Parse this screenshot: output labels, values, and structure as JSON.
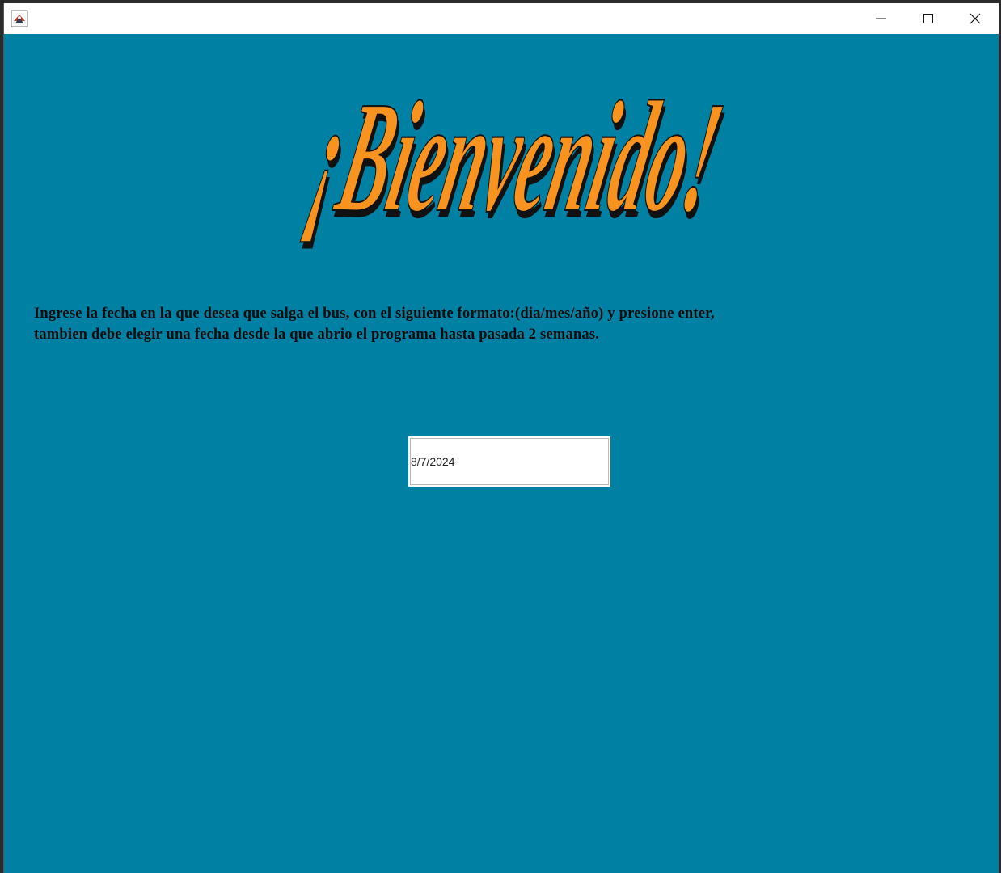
{
  "window": {
    "icon": "java-app-icon",
    "controls": {
      "minimize": "minimize-icon",
      "maximize": "maximize-icon",
      "close": "close-icon"
    }
  },
  "banner": {
    "text": "¡Bienvenido!",
    "colors": {
      "fill": "#f7931e",
      "shadow": "#111111"
    }
  },
  "instructions": {
    "line1": "Ingrese la fecha en la que desea que salga el bus, con el siguiente formato:(dia/mes/año) y presione enter,",
    "line2": "tambien debe elegir una fecha desde la que abrio el programa hasta pasada 2 semanas."
  },
  "date_field": {
    "value": "8/7/2024"
  },
  "colors": {
    "background": "#0081a3",
    "titlebar": "#ffffff",
    "text": "#0b0b0b"
  }
}
